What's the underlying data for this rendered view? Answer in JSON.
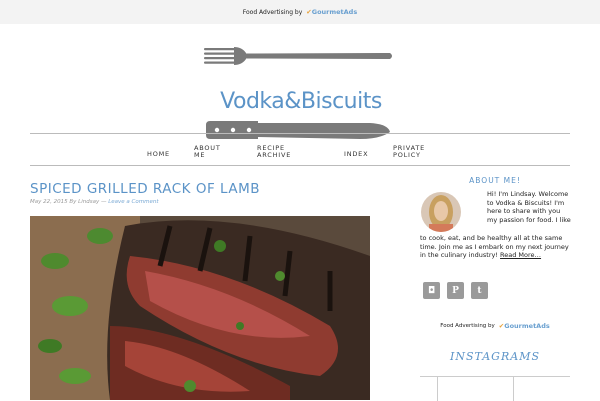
{
  "top_ad": {
    "label": "Food Advertising by",
    "brand": "GourmetAds"
  },
  "site": {
    "name": "Vodka&Biscuits"
  },
  "nav": [
    {
      "line1": "HOME",
      "line2": ""
    },
    {
      "line1": "ABOUT",
      "line2": "ME"
    },
    {
      "line1": "RECIPE",
      "line2": "ARCHIVE"
    },
    {
      "line1": "INDEX",
      "line2": ""
    },
    {
      "line1": "PRIVATE",
      "line2": "POLICY"
    }
  ],
  "post": {
    "title": "SPICED GRILLED RACK OF LAMB",
    "date": "May 22, 2015",
    "by": "By",
    "author": "Lindsay",
    "sep": "—",
    "comment_link": "Leave a Comment"
  },
  "sidebar": {
    "about_heading": "ABOUT ME!",
    "about_text_top": "Hi! I'm Lindsay. Welcome to Vodka & Biscuits! I'm here to share with you my passion for food. I like",
    "about_text_bottom": "to cook, eat, and be healthy all at the same time. Join me as I embark on my next journey in the culinary industry!",
    "read_more": "Read More…",
    "social": [
      {
        "icon": "instagram-icon",
        "glyph": "◘"
      },
      {
        "icon": "pinterest-icon",
        "glyph": "P"
      },
      {
        "icon": "tumblr-icon",
        "glyph": "t"
      }
    ],
    "ad_label": "Food Advertising by",
    "ad_brand": "GourmetAds",
    "instagram_heading": "INSTAGRAMS"
  },
  "colors": {
    "accent": "#5b93c7",
    "topbar": "#f3f3f3",
    "logo_gray": "#7a7a7a"
  }
}
